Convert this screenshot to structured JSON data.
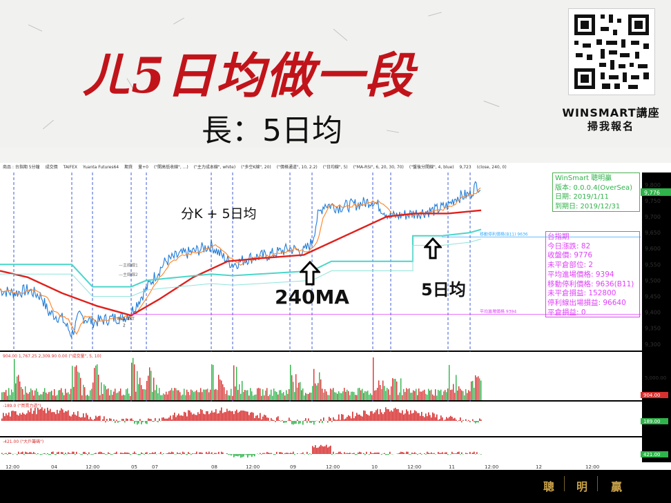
{
  "banner": {
    "title": "ㄦ5日均做一段",
    "subtitle": "長：5日均",
    "brand": "WINSMART講座",
    "brand_cta": "掃我報名"
  },
  "toolbar": {
    "items": [
      "商品 : 台指期 5分鐘",
      "成交價",
      "TAIFEX",
      "Yuanta Futures64",
      "期貨",
      "量+0",
      "(\"開高低收線\", ...)",
      "(\"主力成本線\", white)",
      "(\"多空K線\", 20)",
      "(\"價格通道\", 10, 2.2)",
      "(\"日均線\", 5)",
      "(\"MA-RSI\", 6, 20, 30, 70)",
      "(\"盤後分開線\", 4, blue)",
      "9,723",
      "(close, 240, 0)"
    ]
  },
  "chart_annotations": {
    "sub_label": "分K + 5日均",
    "ma240": "240MA",
    "ma5": "5日均",
    "entry_label": "BE1-8KT",
    "entry_num": "2",
    "main_line1": "—主線線1",
    "main_line2": "—主線線2",
    "trail_stop_label": "移動停利價格(B11) 9636",
    "avg_entry_label": "平均進場價格 9394"
  },
  "info_box_green": {
    "lines": [
      "WinSmart 聰明贏",
      "版本: 0.0.0.4(OverSea)",
      "日期: 2019/1/11",
      "到期日: 2019/12/31"
    ]
  },
  "info_box_pink": {
    "lines": [
      "台指期",
      "今日漲跌: 82",
      "收盤價: 9776",
      "未平倉部位: 2",
      "平均進場價格: 9394",
      "移動停利價格: 9636(B11)",
      "未平倉損益: 152800",
      "停利線出場損益: 96640",
      "平倉損益: 0"
    ]
  },
  "price_axis": {
    "labels": [
      "9,800",
      "9,750",
      "9,700",
      "9,650",
      "9,600",
      "9,550",
      "9,500",
      "9,450",
      "9,400",
      "9,350",
      "9,300"
    ],
    "last_price": "9,776"
  },
  "volume_panel": {
    "header": "904.00  1,767.25  2,309.90  0.00",
    "study": "(\"成交量\", 5, 10)",
    "axis_label": "5,000.00",
    "last": "904.00"
  },
  "power_panel": {
    "header": "-189.0",
    "study": "(\"買賣力道\")",
    "last": "189.00"
  },
  "bigplayer_panel": {
    "header": "-421.00",
    "study": "(\"大戶籌碼\")",
    "last": "421.00"
  },
  "time_axis": {
    "labels": [
      "12:00",
      "04",
      "12:00",
      "05",
      "07",
      "08",
      "12:00",
      "09",
      "12:00",
      "10",
      "12:00",
      "11",
      "12:00",
      "12",
      "12:00"
    ]
  },
  "footer": {
    "chars": [
      "聰",
      "明",
      "贏"
    ]
  },
  "colors": {
    "title_red": "#c1141a",
    "ma240": "#e0201c",
    "ma5": "#49d6c9",
    "price": "#1f7bd8",
    "orange": "#ff8a30",
    "up": "#d83030",
    "down": "#2fb34a",
    "gold": "#c9a24a"
  }
}
